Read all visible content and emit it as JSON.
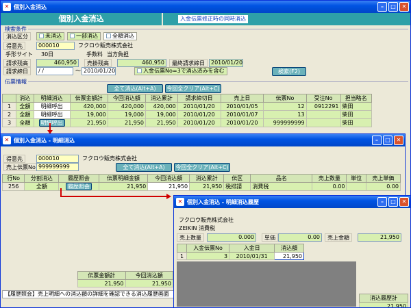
{
  "main": {
    "title": "個別入金消込",
    "header_title": "個別入金消込",
    "header_note": "入金伝票修正時の同時消込",
    "search_section": "検索条件",
    "cond_label": "消込区分",
    "cond_options": [
      "未消込",
      "一部消込",
      "全額消込"
    ],
    "customer_label": "得意先",
    "customer_code": "000010",
    "customer_name": "フクロウ販売株式会社",
    "site_label": "手形サイト",
    "site_value": "30日",
    "fee_label": "手数料",
    "fee_value": "当方負担",
    "balance_label": "請求残高",
    "balance_value": "460,950",
    "sales_balance_label": "売掛残高",
    "sales_balance_value": "460,950",
    "last_date_label": "最終請求締日",
    "last_date_value": "2010/01/20",
    "close_date_label": "請求締日",
    "close_date_from": "/ /",
    "tilde": "〜",
    "close_date_to": "2010/01/20",
    "include_label": "入金伝票No=3で消込済みを含む",
    "search_button": "検索(F2)",
    "slip_section": "伝票情報",
    "clear_all_button": "全て消込(Alt+A)",
    "clear_this_button": "今回全クリア(Alt+C)",
    "columns": [
      "消込",
      "明細消込",
      "伝票金額計",
      "今回消込額",
      "消込累計",
      "請求締切日",
      "売上日",
      "伝票No",
      "受注No",
      "担当略名"
    ],
    "rows": [
      {
        "no": "1",
        "status": "全額",
        "detail": "明細呼出",
        "amount": "420,000",
        "current": "420,000",
        "cumulative": "420,000",
        "close": "2010/01/20",
        "sale_date": "2010/01/05",
        "slip": "12",
        "order": "0912291",
        "staff": "柴田"
      },
      {
        "no": "2",
        "status": "全額",
        "detail": "明細呼出",
        "amount": "19,000",
        "current": "19,000",
        "cumulative": "19,000",
        "close": "2010/01/20",
        "sale_date": "2010/01/07",
        "slip": "13",
        "order": "",
        "staff": "柴田"
      },
      {
        "no": "3",
        "status": "全額",
        "detail": "明細呼出",
        "amount": "21,950",
        "current": "21,950",
        "cumulative": "21,950",
        "close": "2010/01/20",
        "sale_date": "2010/01/20",
        "slip": "999999999",
        "order": "",
        "staff": "柴田"
      }
    ]
  },
  "detail": {
    "title": "個別入金消込 - 明細消込",
    "customer_label": "得意先",
    "customer_code": "000010",
    "customer_name": "フクロウ販売株式会社",
    "slip_label": "売上伝票No",
    "slip_value": "999999999",
    "clear_all_button": "全て消込(Alt+A)",
    "clear_this_button": "今回全クリア(Alt+C)",
    "columns": [
      "行No",
      "分割消込",
      "履歴照会",
      "伝票明細金額",
      "今回消込額",
      "消込累計",
      "伝区",
      "品名"
    ],
    "extra_columns": [
      "売上数量",
      "単位",
      "売上単価"
    ],
    "row": {
      "no": "256",
      "status": "全額",
      "history": "履歴照会",
      "amount": "21,950",
      "current": "21,950",
      "cumulative": "21,950",
      "kind": "税排請",
      "item": "消費税",
      "qty": "0.00",
      "unit": "",
      "price": "0.00"
    },
    "sum_columns": [
      "伝票金額計",
      "今回消込額"
    ],
    "sum_amount": "21,950",
    "sum_current": "21,950",
    "footnote": "【履歴照会】売上明細への消込額の詳細を確認できる消込履歴画面"
  },
  "history": {
    "title": "個別入金消込 - 明細消込履歴",
    "customer_name": "フクロウ販売株式会社",
    "item_line": "ZEIKIN 消費税",
    "qty_label": "売上数量",
    "qty_value": "0.000",
    "price_label": "単価",
    "price_value": "0.00",
    "amount_label": "売上金額",
    "amount_value": "21,950",
    "columns": [
      "入金伝票No",
      "入金日",
      "消込額"
    ],
    "rows": [
      {
        "no": "1",
        "slip": "3",
        "date": "2010/01/31",
        "amount": "21,950"
      }
    ],
    "total_label": "消込履歴計",
    "total_value": "21,950"
  },
  "colors": {
    "titlebar": "#0054e3",
    "header_bar": "#2ea0a8",
    "grid_row": "#d8f0b0",
    "arrow": "#d00000"
  }
}
